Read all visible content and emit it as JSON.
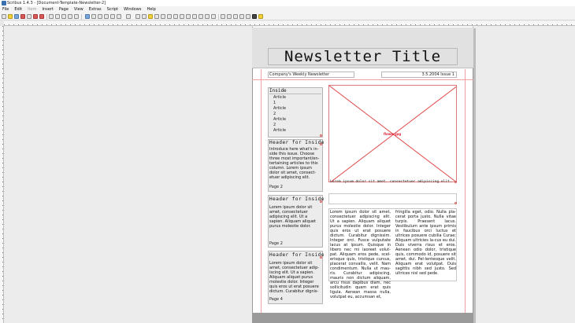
{
  "window": {
    "title": "Scribus 1.4.3 - [Document-Template-Newsletter-2]"
  },
  "menu": [
    {
      "label": "File",
      "enabled": true
    },
    {
      "label": "Edit",
      "enabled": true
    },
    {
      "label": "Item",
      "enabled": false
    },
    {
      "label": "Insert",
      "enabled": true
    },
    {
      "label": "Page",
      "enabled": true
    },
    {
      "label": "View",
      "enabled": true
    },
    {
      "label": "Extras",
      "enabled": true
    },
    {
      "label": "Script",
      "enabled": true
    },
    {
      "label": "Windows",
      "enabled": true
    },
    {
      "label": "Help",
      "enabled": true
    }
  ],
  "document": {
    "title": "Newsletter Title",
    "company": "Company's Weekly Newsletter",
    "issue": "3.5.2004 Issue 1"
  },
  "toc": {
    "heading": "Inside",
    "items": [
      {
        "label": "Article"
      },
      {
        "label": "1"
      },
      {
        "label": "Article"
      },
      {
        "label": "2"
      },
      {
        "label": "Article"
      },
      {
        "label": "2"
      },
      {
        "label": "Article"
      }
    ]
  },
  "sidebar": [
    {
      "heading": "Header for Inside",
      "text": "Introduce here what's in-side this issue. Choose three most important/en-tertaining articles to this column. Lorem ipsum dolor sit amet, consect-etuer adipiscing elit.",
      "page": "Page 2"
    },
    {
      "heading": "Header for Inside",
      "text": "Lorem ipsum dolor sit amet, consectetuer adipiscing elit. Ut a sapien. Aliquam aliquet purus molestie dolor.",
      "page": "Page 2"
    },
    {
      "heading": "Header for Inside",
      "text": "Lorem ipsum dolor sit amet, consectetuer adip-iscing elit. Ut a sapien. Aliquam aliquet purus molestie dolor. Integer quis eros ut erat posuere dictum. Curabitur dignis-",
      "page": "Page 4"
    }
  ],
  "image": {
    "filename": "flower.jpg",
    "caption": "Lorem ipsum dolor sit amet. consectetuer adipiscing elit."
  },
  "article": {
    "col1": "Lorem ipsum dolor sit amet, consectetuer adipiscing elit. Ut a sapien. Aliquam aliquet purus molestie dolor. Integer quis eros ut erat posuere dictum. Curabitur dignissim. Integer orci. Fusce vulputate lacus at ipsum. Quisque in libero nec mi laoreet volut-pat. Aliquam eros pede, scel-erisque quis, tristique cursus, placerat convallis, velit. Nam condimentum. Nulla ut mau-ris. Curabitur adipiscing, mauris non dictum aliquam, arcu risus dapibus diam, nec sollicitudin quam erat quis ligula. Aenean massa nulla, volutpat eu, accumsan et,",
    "col2": "fringilla eget, odio. Nulla pla-cerat porta justo. Nulla vitae turpis. Praesent lacus. Vestibulum ante ipsum primis in faucibus orci luctus et ultrices posuere cubilia Curae; Aliquam ultricies la-cus eu dui. Duis viverra risus et eros. Aenean odio dolor, tristique quis, commodo id, posuere sit amet, dui. Pel-lentesque velit. Aliquam erat volutpat. Duis sagittis nibh sed justo. Sed ultrices nisl sed pede."
  },
  "colors": {
    "margin_guide": "#f0a0a0",
    "image_frame": "#e07a7a",
    "banner": "#e1e1e1",
    "pasteboard": "#ececec"
  }
}
